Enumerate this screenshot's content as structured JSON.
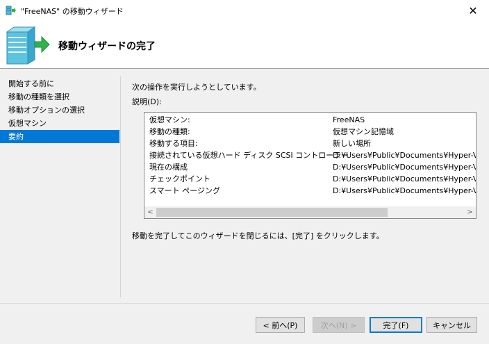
{
  "window": {
    "title": "\"FreeNAS\" の移動ウィザード",
    "close_glyph": "✕"
  },
  "header": {
    "title": "移動ウィザードの完了"
  },
  "sidebar": {
    "items": [
      {
        "label": "開始する前に",
        "active": false
      },
      {
        "label": "移動の種類を選択",
        "active": false
      },
      {
        "label": "移動オプションの選択",
        "active": false
      },
      {
        "label": "仮想マシン",
        "active": false
      },
      {
        "label": "要約",
        "active": true
      }
    ]
  },
  "main": {
    "intro": "次の操作を実行しようとしています。",
    "description_label": "説明(D):",
    "rows": [
      {
        "key": "仮想マシン:",
        "value": "FreeNAS"
      },
      {
        "key": "移動の種類:",
        "value": "仮想マシン記憶域"
      },
      {
        "key": "移動する項目:",
        "value": "新しい場所"
      },
      {
        "key": "接続されている仮想ハード ディスク SCSI コントローラー",
        "value": "D:¥Users¥Public¥Documents¥Hyper-V¥Virtu"
      },
      {
        "key": "現在の構成",
        "value": "D:¥Users¥Public¥Documents¥Hyper-V¥Virtu"
      },
      {
        "key": "チェックポイント",
        "value": "D:¥Users¥Public¥Documents¥Hyper-V¥Virtu"
      },
      {
        "key": "スマート ページング",
        "value": "D:¥Users¥Public¥Documents¥Hyper-V¥Virtu"
      }
    ],
    "scroll_left_glyph": "<",
    "scroll_right_glyph": ">",
    "footer": "移動を完了してこのウィザードを閉じるには、[完了] をクリックします。"
  },
  "buttons": {
    "prev": "< 前へ(P)",
    "next": "次へ(N) >",
    "finish": "完了(F)",
    "cancel": "キャンセル"
  },
  "colors": {
    "accent": "#0078d7",
    "icon_teal": "#4fb8d8",
    "arrow_green": "#2fb34a"
  },
  "icons": {
    "app": "wizard-app-icon",
    "header": "server-move-icon"
  }
}
